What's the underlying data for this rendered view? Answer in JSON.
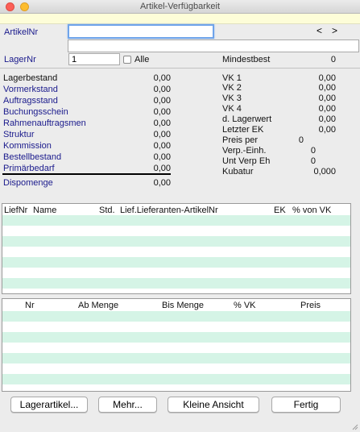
{
  "window": {
    "title": "Artikel-Verfügbarkeit"
  },
  "header": {
    "artikelnr_label": "ArtikelNr",
    "artikelnr_value": "",
    "nav_prev": "<",
    "nav_next": ">",
    "description_value": "",
    "lagernr_label": "LagerNr",
    "lagernr_value": "1",
    "alle_label": "Alle",
    "alle_checked": false,
    "mindestbest_label": "Mindestbest",
    "mindestbest_value": "0"
  },
  "stock": [
    {
      "label": "Lagerbestand",
      "value": "0,00",
      "link": false
    },
    {
      "label": "Vormerkstand",
      "value": "0,00",
      "link": true
    },
    {
      "label": "Auftragsstand",
      "value": "0,00",
      "link": true
    },
    {
      "label": "Buchungsschein",
      "value": "0,00",
      "link": true
    },
    {
      "label": "Rahmenauftragsmen",
      "value": "0,00",
      "link": true
    },
    {
      "label": "Struktur",
      "value": "0,00",
      "link": true
    },
    {
      "label": "Kommission",
      "value": "0,00",
      "link": true
    },
    {
      "label": "Bestellbestand",
      "value": "0,00",
      "link": true
    },
    {
      "label": "Primärbedarf",
      "value": "0,00",
      "link": true
    },
    {
      "label": "Dispomenge",
      "value": "0,00",
      "link": true
    }
  ],
  "prices": [
    {
      "label": "VK 1",
      "value": "0,00"
    },
    {
      "label": "VK 2",
      "value": "0,00"
    },
    {
      "label": "VK 3",
      "value": "0,00"
    },
    {
      "label": "VK 4",
      "value": "0,00"
    },
    {
      "label": "d. Lagerwert",
      "value": "0,00"
    },
    {
      "label": "Letzter EK",
      "value": "0,00"
    },
    {
      "label": "Preis per",
      "value": "0"
    },
    {
      "label": "Verp.-Einh.",
      "value": "0"
    },
    {
      "label": "Unt Verp Eh",
      "value": "0"
    },
    {
      "label": "Kubatur",
      "value": "0,000"
    }
  ],
  "supplier_table": {
    "headers": [
      "LiefNr",
      "Name",
      "Std.",
      "Lief.Lieferanten-ArtikelNr",
      "EK",
      "% von VK"
    ],
    "rows": []
  },
  "quantity_table": {
    "headers": [
      "Nr",
      "Ab Menge",
      "Bis Menge",
      "% VK",
      "Preis"
    ],
    "rows": []
  },
  "buttons": {
    "lagerartikel": "Lagerartikel...",
    "mehr": "Mehr...",
    "kleine_ansicht": "Kleine Ansicht",
    "fertig": "Fertig"
  },
  "colors": {
    "link_label": "#1a1a8c",
    "row_stripe": "#d5f4e6",
    "yellow_bar": "#fdfdd8"
  }
}
